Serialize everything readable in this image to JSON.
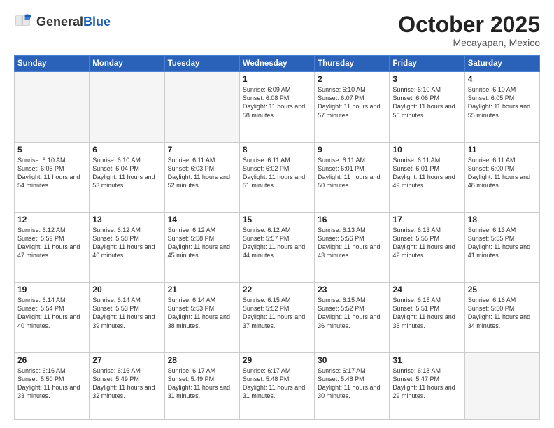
{
  "header": {
    "logo_general": "General",
    "logo_blue": "Blue",
    "month": "October 2025",
    "location": "Mecayapan, Mexico"
  },
  "days_of_week": [
    "Sunday",
    "Monday",
    "Tuesday",
    "Wednesday",
    "Thursday",
    "Friday",
    "Saturday"
  ],
  "weeks": [
    [
      {
        "day": "",
        "empty": true
      },
      {
        "day": "",
        "empty": true
      },
      {
        "day": "",
        "empty": true
      },
      {
        "day": "1",
        "sunrise": "6:09 AM",
        "sunset": "6:08 PM",
        "daylight": "11 hours and 58 minutes."
      },
      {
        "day": "2",
        "sunrise": "6:10 AM",
        "sunset": "6:07 PM",
        "daylight": "11 hours and 57 minutes."
      },
      {
        "day": "3",
        "sunrise": "6:10 AM",
        "sunset": "6:06 PM",
        "daylight": "11 hours and 56 minutes."
      },
      {
        "day": "4",
        "sunrise": "6:10 AM",
        "sunset": "6:05 PM",
        "daylight": "11 hours and 55 minutes."
      }
    ],
    [
      {
        "day": "5",
        "sunrise": "6:10 AM",
        "sunset": "6:05 PM",
        "daylight": "11 hours and 54 minutes."
      },
      {
        "day": "6",
        "sunrise": "6:10 AM",
        "sunset": "6:04 PM",
        "daylight": "11 hours and 53 minutes."
      },
      {
        "day": "7",
        "sunrise": "6:11 AM",
        "sunset": "6:03 PM",
        "daylight": "11 hours and 52 minutes."
      },
      {
        "day": "8",
        "sunrise": "6:11 AM",
        "sunset": "6:02 PM",
        "daylight": "11 hours and 51 minutes."
      },
      {
        "day": "9",
        "sunrise": "6:11 AM",
        "sunset": "6:01 PM",
        "daylight": "11 hours and 50 minutes."
      },
      {
        "day": "10",
        "sunrise": "6:11 AM",
        "sunset": "6:01 PM",
        "daylight": "11 hours and 49 minutes."
      },
      {
        "day": "11",
        "sunrise": "6:11 AM",
        "sunset": "6:00 PM",
        "daylight": "11 hours and 48 minutes."
      }
    ],
    [
      {
        "day": "12",
        "sunrise": "6:12 AM",
        "sunset": "5:59 PM",
        "daylight": "11 hours and 47 minutes."
      },
      {
        "day": "13",
        "sunrise": "6:12 AM",
        "sunset": "5:58 PM",
        "daylight": "11 hours and 46 minutes."
      },
      {
        "day": "14",
        "sunrise": "6:12 AM",
        "sunset": "5:58 PM",
        "daylight": "11 hours and 45 minutes."
      },
      {
        "day": "15",
        "sunrise": "6:12 AM",
        "sunset": "5:57 PM",
        "daylight": "11 hours and 44 minutes."
      },
      {
        "day": "16",
        "sunrise": "6:13 AM",
        "sunset": "5:56 PM",
        "daylight": "11 hours and 43 minutes."
      },
      {
        "day": "17",
        "sunrise": "6:13 AM",
        "sunset": "5:55 PM",
        "daylight": "11 hours and 42 minutes."
      },
      {
        "day": "18",
        "sunrise": "6:13 AM",
        "sunset": "5:55 PM",
        "daylight": "11 hours and 41 minutes."
      }
    ],
    [
      {
        "day": "19",
        "sunrise": "6:14 AM",
        "sunset": "5:54 PM",
        "daylight": "11 hours and 40 minutes."
      },
      {
        "day": "20",
        "sunrise": "6:14 AM",
        "sunset": "5:53 PM",
        "daylight": "11 hours and 39 minutes."
      },
      {
        "day": "21",
        "sunrise": "6:14 AM",
        "sunset": "5:53 PM",
        "daylight": "11 hours and 38 minutes."
      },
      {
        "day": "22",
        "sunrise": "6:15 AM",
        "sunset": "5:52 PM",
        "daylight": "11 hours and 37 minutes."
      },
      {
        "day": "23",
        "sunrise": "6:15 AM",
        "sunset": "5:52 PM",
        "daylight": "11 hours and 36 minutes."
      },
      {
        "day": "24",
        "sunrise": "6:15 AM",
        "sunset": "5:51 PM",
        "daylight": "11 hours and 35 minutes."
      },
      {
        "day": "25",
        "sunrise": "6:16 AM",
        "sunset": "5:50 PM",
        "daylight": "11 hours and 34 minutes."
      }
    ],
    [
      {
        "day": "26",
        "sunrise": "6:16 AM",
        "sunset": "5:50 PM",
        "daylight": "11 hours and 33 minutes."
      },
      {
        "day": "27",
        "sunrise": "6:16 AM",
        "sunset": "5:49 PM",
        "daylight": "11 hours and 32 minutes."
      },
      {
        "day": "28",
        "sunrise": "6:17 AM",
        "sunset": "5:49 PM",
        "daylight": "11 hours and 31 minutes."
      },
      {
        "day": "29",
        "sunrise": "6:17 AM",
        "sunset": "5:48 PM",
        "daylight": "11 hours and 31 minutes."
      },
      {
        "day": "30",
        "sunrise": "6:17 AM",
        "sunset": "5:48 PM",
        "daylight": "11 hours and 30 minutes."
      },
      {
        "day": "31",
        "sunrise": "6:18 AM",
        "sunset": "5:47 PM",
        "daylight": "11 hours and 29 minutes."
      },
      {
        "day": "",
        "empty": true
      }
    ]
  ]
}
